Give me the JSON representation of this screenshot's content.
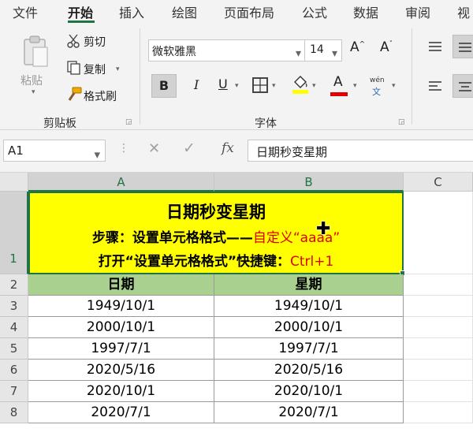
{
  "tabs": [
    "文件",
    "开始",
    "插入",
    "绘图",
    "页面布局",
    "公式",
    "数据",
    "审阅",
    "视"
  ],
  "active_tab": "开始",
  "ribbon": {
    "clipboard": {
      "paste": "粘贴",
      "cut": "剪切",
      "copy": "复制",
      "format_painter": "格式刷",
      "group_label": "剪贴板"
    },
    "font": {
      "font_name": "微软雅黑",
      "font_size": "14",
      "bold": "B",
      "italic": "I",
      "underline": "U",
      "grow": "A",
      "shrink": "A",
      "font_color_letter": "A",
      "phonetic_top": "wén",
      "phonetic_bottom": "文",
      "group_label": "字体"
    }
  },
  "formula_bar": {
    "name_box": "A1",
    "fx": "fx",
    "content": "日期秒变星期"
  },
  "grid": {
    "columns": [
      "A",
      "B",
      "C"
    ],
    "rows": [
      "1",
      "2",
      "3",
      "4",
      "5",
      "6",
      "7",
      "8"
    ],
    "title": {
      "main": "日期秒变星期",
      "line2_prefix": "步骤：设置单元格格式——",
      "line2_red": "自定义“aaaa”",
      "line3_prefix": "打开“设置单元格格式”快捷键：",
      "line3_red": "Ctrl+1"
    },
    "headers": [
      "日期",
      "星期"
    ],
    "data": [
      [
        "1949/10/1",
        "1949/10/1"
      ],
      [
        "2000/10/1",
        "2000/10/1"
      ],
      [
        "1997/7/1",
        "1997/7/1"
      ],
      [
        "2020/5/16",
        "2020/5/16"
      ],
      [
        "2020/10/1",
        "2020/10/1"
      ],
      [
        "2020/7/1",
        "2020/7/1"
      ]
    ]
  },
  "colors": {
    "title_fill": "#ffff00",
    "header_fill": "#a9d08e",
    "accent": "#217346",
    "red_text": "#e00000"
  }
}
